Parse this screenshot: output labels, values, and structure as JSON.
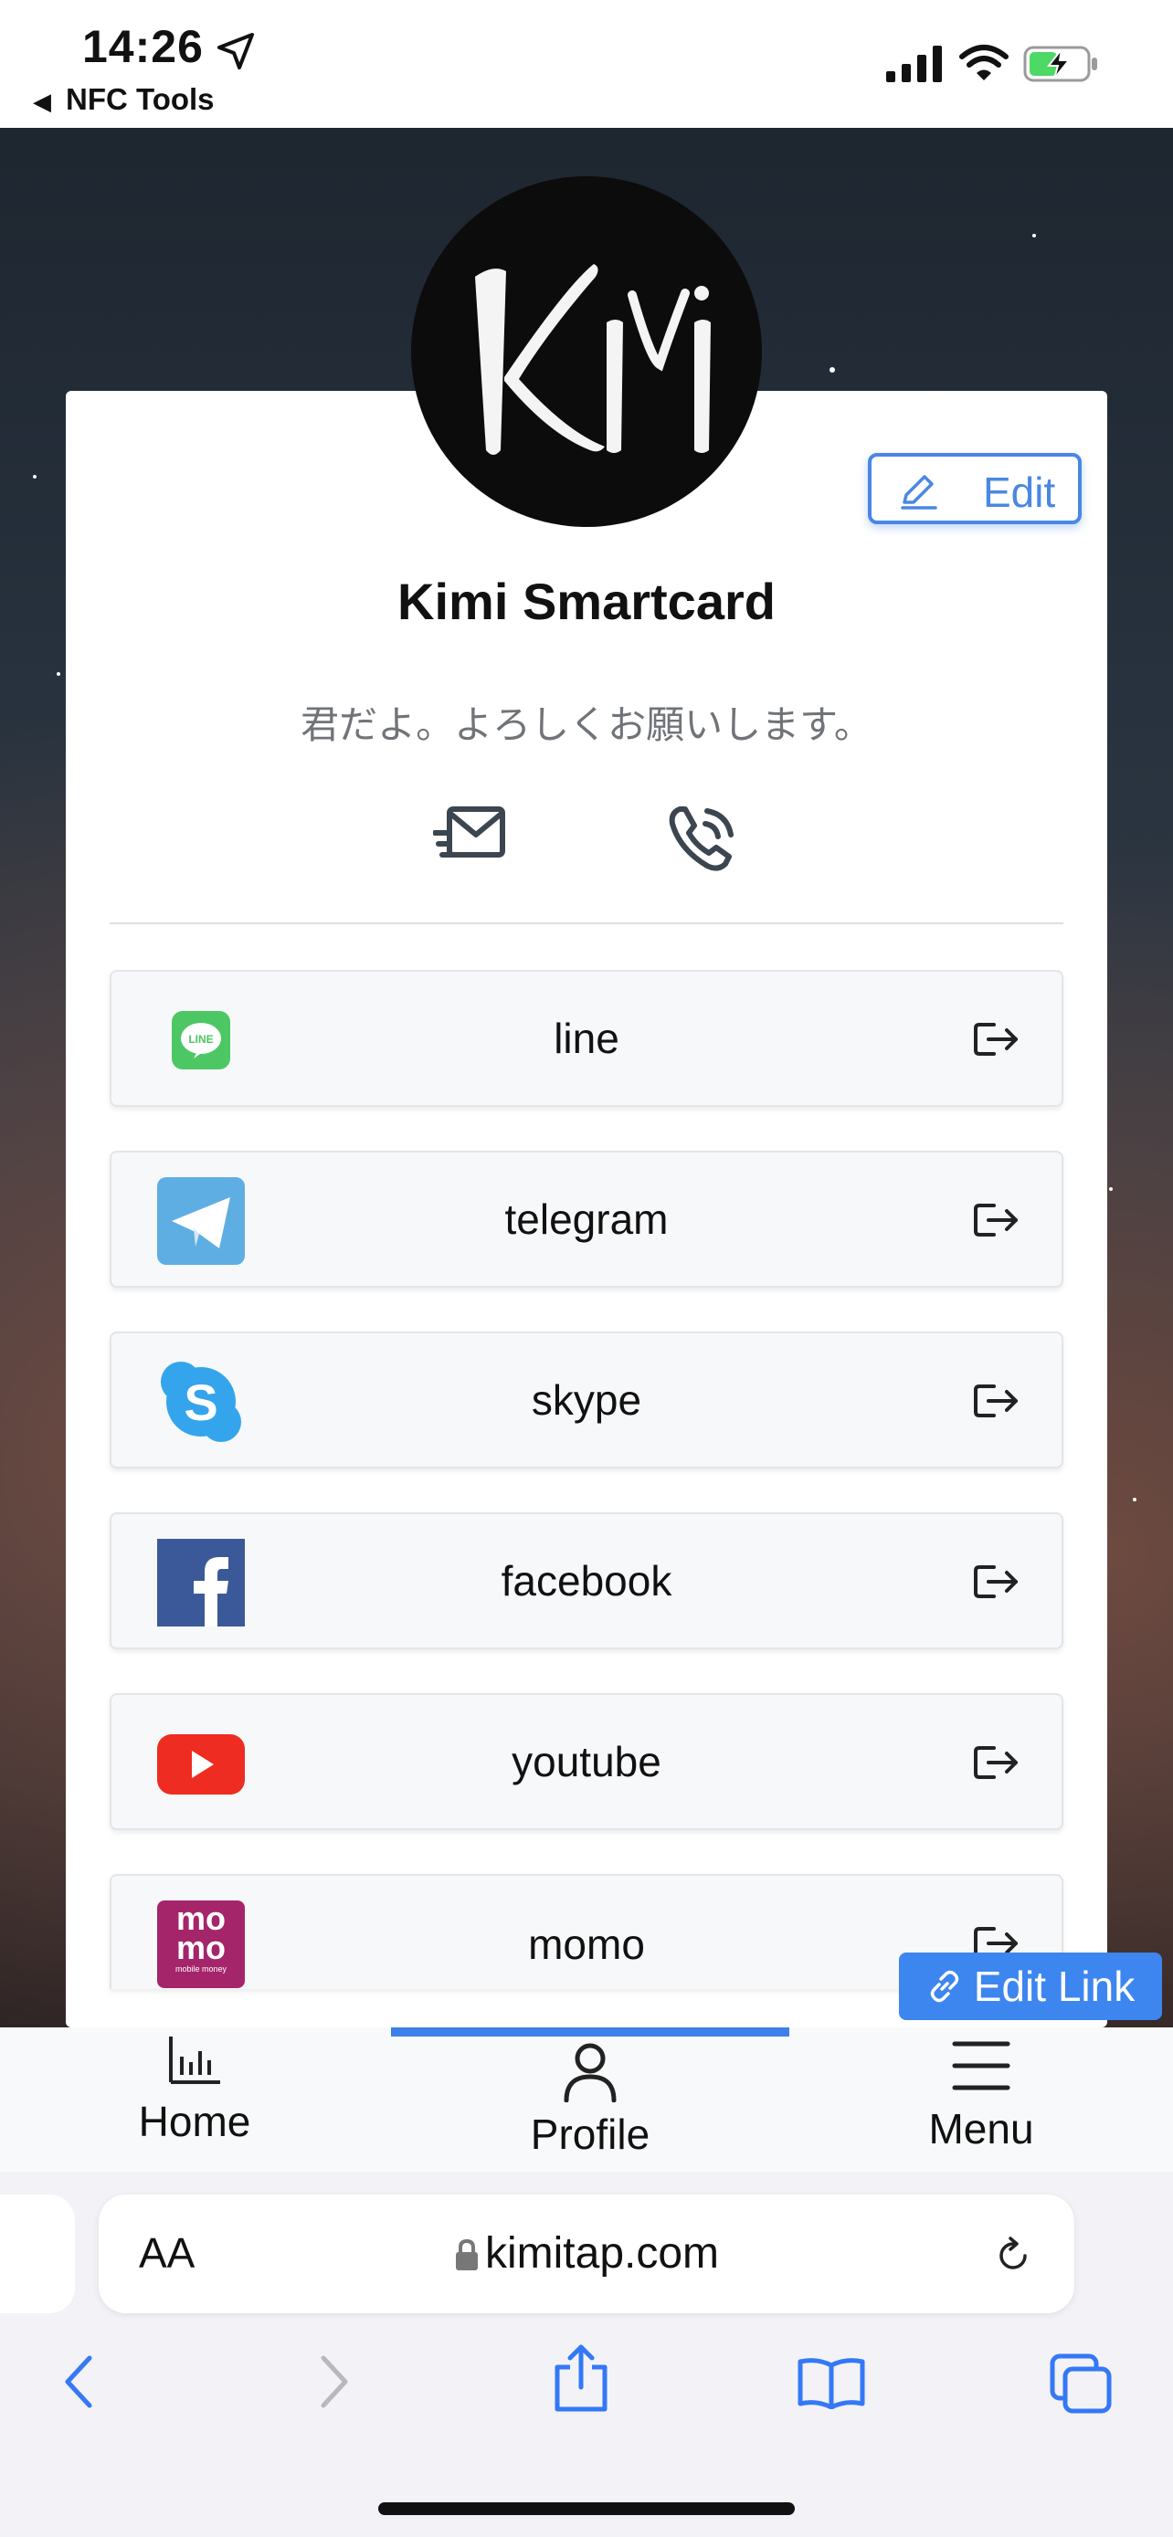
{
  "status_bar": {
    "time": "14:26",
    "back_app": "NFC Tools"
  },
  "profile": {
    "logo_text": "KiMi",
    "name": "Kimi Smartcard",
    "bio": "君だよ。よろしくお願いします。",
    "edit_label": "Edit"
  },
  "links": [
    {
      "label": "line",
      "icon": "line-logo"
    },
    {
      "label": "telegram",
      "icon": "telegram-logo"
    },
    {
      "label": "skype",
      "icon": "skype-logo"
    },
    {
      "label": "facebook",
      "icon": "facebook-logo"
    },
    {
      "label": "youtube",
      "icon": "youtube-logo"
    },
    {
      "label": "momo",
      "icon": "momo-logo",
      "icon_text_top": "mo",
      "icon_text_bottom": "mo",
      "icon_caption": "mobile money"
    }
  ],
  "edit_link_label": "Edit Link",
  "tabbar": {
    "active": "Profile",
    "tabs": [
      {
        "label": "Home",
        "icon": "bar-chart-icon"
      },
      {
        "label": "Profile",
        "icon": "person-icon"
      },
      {
        "label": "Menu",
        "icon": "hamburger-icon"
      }
    ]
  },
  "browser": {
    "text_size_label": "AA",
    "url": "kimitap.com"
  },
  "colors": {
    "accent": "#3d86ef",
    "edit_border": "#4a87e3",
    "line_green": "#4cc764",
    "telegram": "#5eaee4",
    "skype": "#34a5ec",
    "facebook": "#3b5998",
    "youtube": "#ee2c21",
    "momo": "#a4256a"
  }
}
